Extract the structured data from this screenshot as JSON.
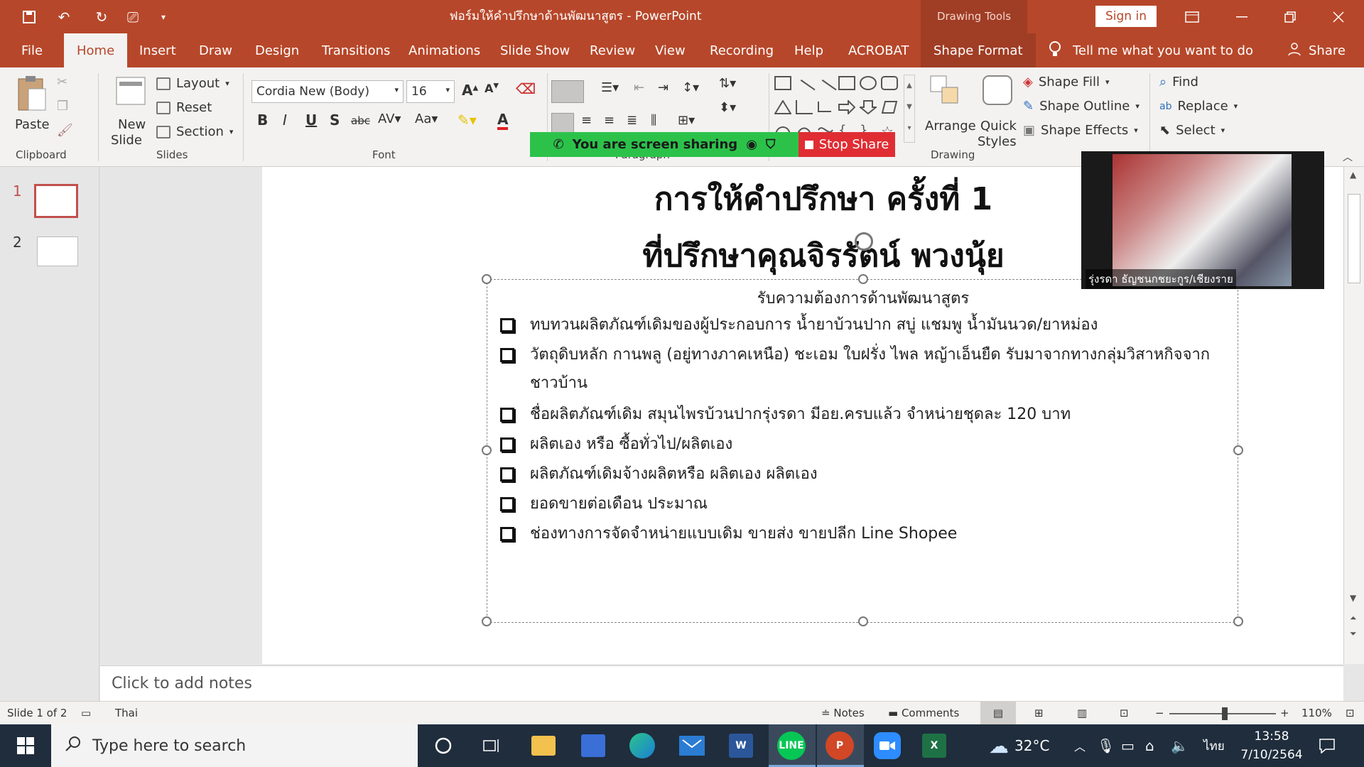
{
  "titlebar": {
    "doc_title": "ฟอร์มให้คำปรึกษาด้านพัฒนาสูตร - PowerPoint",
    "drawing_tools": "Drawing Tools",
    "sign_in": "Sign in"
  },
  "tabs": [
    "File",
    "Home",
    "Insert",
    "Draw",
    "Design",
    "Transitions",
    "Animations",
    "Slide Show",
    "Review",
    "View",
    "Recording",
    "Help",
    "ACROBAT",
    "Shape Format"
  ],
  "tell_me": "Tell me what you want to do",
  "share": "Share",
  "ribbon": {
    "clipboard": {
      "paste": "Paste",
      "label": "Clipboard"
    },
    "slides": {
      "new_slide_1": "New",
      "new_slide_2": "Slide",
      "layout": "Layout",
      "reset": "Reset",
      "section": "Section",
      "label": "Slides"
    },
    "font": {
      "name": "Cordia New (Body)",
      "size": "16",
      "label": "Font"
    },
    "paragraph": {
      "label": "Paragraph"
    },
    "drawing": {
      "arrange": "Arrange",
      "quick_styles_1": "Quick",
      "quick_styles_2": "Styles",
      "shape_fill": "Shape Fill",
      "shape_outline": "Shape Outline",
      "shape_effects": "Shape Effects",
      "label": "Drawing"
    },
    "editing": {
      "find": "Find",
      "replace": "Replace",
      "select": "Select"
    }
  },
  "share_bar": {
    "message": "You are screen sharing",
    "stop": "Stop Share"
  },
  "thumbnails": [
    "1",
    "2"
  ],
  "slide": {
    "title1": "การให้คำปรึกษา ครั้งที่ 1",
    "title2": "ที่ปรึกษาคุณจิรรัตน์ พวงนุ้ย",
    "heading": "รับความต้องการด้านพัฒนาสูตร",
    "bullets": [
      "ทบทวนผลิตภัณฑ์เดิมของผู้ประกอบการ น้ำยาบ้วนปาก สบู่ แชมพู น้ำมันนวด/ยาหม่อง",
      "วัตถุดิบหลัก กานพลู (อยู่ทางภาคเหนือ) ชะเอม ใบฝรั่ง ไพล หญ้าเอ็นยืด รับมาจากทางกลุ่มวิสาหกิจจากชาวบ้าน",
      "ชื่อผลิตภัณฑ์เดิม สมุนไพรบ้วนปากรุ่งรดา มีอย.ครบแล้ว จำหน่ายชุดละ 120 บาท",
      "ผลิตเอง หรือ ซื้อทั่วไป/ผลิตเอง",
      "ผลิตภัณฑ์เดิมจ้างผลิตหรือ ผลิตเอง ผลิตเอง",
      "ยอดขายต่อเดือน ประมาณ",
      "ช่องทางการจัดจำหน่ายแบบเดิม ขายส่ง ขายปลีก Line Shopee"
    ]
  },
  "video": {
    "name": "รุ่งรดา ธัญชนกชยะกูร/เชียงราย"
  },
  "notes_placeholder": "Click to add notes",
  "status": {
    "slide": "Slide 1 of 2",
    "language": "Thai",
    "notes": "Notes",
    "comments": "Comments",
    "zoom": "110%"
  },
  "taskbar": {
    "search": "Type here to search",
    "temperature": "32°C",
    "lang": "ไทย",
    "time": "13:58",
    "date": "7/10/2564"
  }
}
